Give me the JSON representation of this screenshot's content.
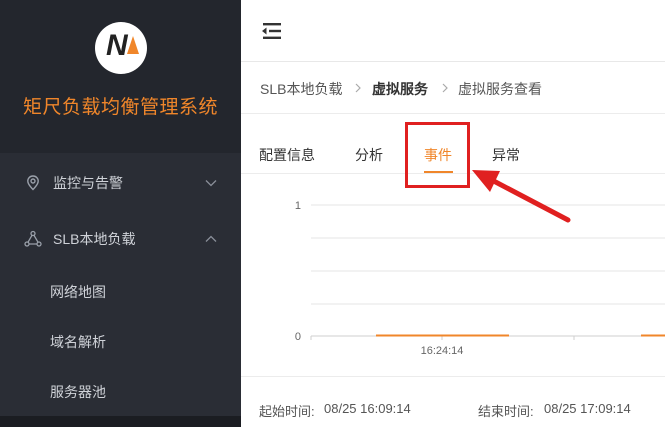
{
  "brand": {
    "logo_text": "N",
    "title": "矩尺负载均衡管理系统"
  },
  "sidebar": {
    "items": [
      {
        "label": "监控与告警",
        "icon": "location-pin-icon",
        "expanded": false
      },
      {
        "label": "SLB本地负载",
        "icon": "network-nodes-icon",
        "expanded": true
      }
    ],
    "sub_items": [
      {
        "label": "网络地图"
      },
      {
        "label": "域名解析"
      },
      {
        "label": "服务器池"
      }
    ]
  },
  "breadcrumb": {
    "items": [
      "SLB本地负载",
      "虚拟服务",
      "虚拟服务查看"
    ]
  },
  "tabs": {
    "items": [
      "配置信息",
      "分析",
      "事件",
      "异常"
    ],
    "active_index": 2
  },
  "chart_data": {
    "type": "line",
    "yticks": [
      "1",
      "0"
    ],
    "xticks": [
      "16:24:14"
    ],
    "ylim": [
      0,
      1
    ],
    "series_color": "#f0862a",
    "grid": true
  },
  "footer": {
    "start_label": "起始时间:",
    "start_value": "08/25 16:09:14",
    "end_label": "结束时间:",
    "end_value": "08/25 17:09:14"
  },
  "colors": {
    "accent": "#f0862a",
    "annotation": "#e02020",
    "sidebar_bg": "#2a2d35"
  }
}
